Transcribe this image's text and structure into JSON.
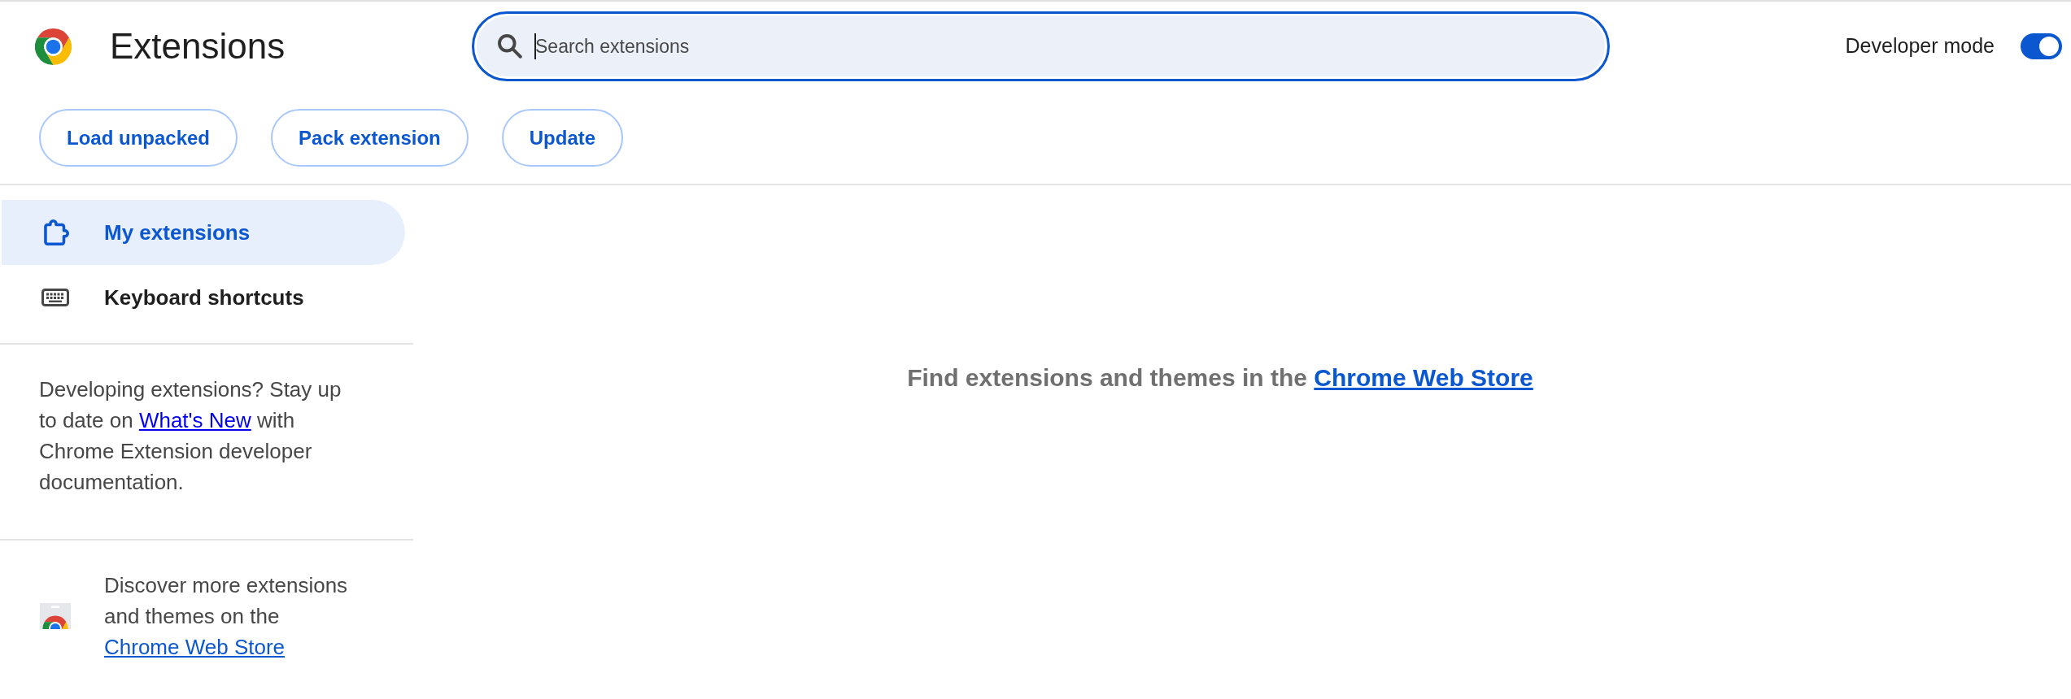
{
  "header": {
    "title": "Extensions",
    "search": {
      "placeholder": "Search extensions",
      "focused": true
    },
    "developer_mode": {
      "label": "Developer mode",
      "on": true
    }
  },
  "toolbar": {
    "buttons": [
      "Load unpacked",
      "Pack extension",
      "Update"
    ]
  },
  "sidebar": {
    "items": [
      {
        "label": "My extensions",
        "kind": "extensions",
        "selected": true
      },
      {
        "label": "Keyboard shortcuts",
        "kind": "shortcuts",
        "selected": false
      }
    ],
    "developer_note": {
      "text_before": "Developing extensions? Stay up to date on",
      "link": "What's New",
      "text_after": "with Chrome Extension developer documentation."
    },
    "store_promo": {
      "text": "Discover more extensions and themes on the",
      "link": "Chrome Web Store"
    }
  },
  "main": {
    "empty_message": {
      "text": "Find extensions and themes in the",
      "link": "Chrome Web Store"
    }
  }
}
